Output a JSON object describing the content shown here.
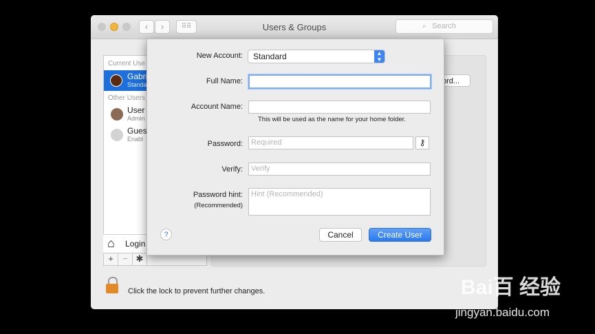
{
  "window": {
    "title": "Users & Groups",
    "search_placeholder": "Search",
    "lock_text": "Click the lock to prevent further changes."
  },
  "sidebar": {
    "current_users_label": "Current Use",
    "other_users_label": "Other Users",
    "users": [
      {
        "name": "Gabri",
        "role": "Standa"
      },
      {
        "name": "User",
        "role": "Admin"
      },
      {
        "name": "Gues",
        "role": "Enabl"
      }
    ],
    "login_label": "Login",
    "add_label": "+",
    "remove_label": "−",
    "gear_label": "✱"
  },
  "right_panel": {
    "password_button": "ord..."
  },
  "sheet": {
    "new_account_label": "New Account:",
    "new_account_value": "Standard",
    "full_name_label": "Full Name:",
    "full_name_value": "",
    "account_name_label": "Account Name:",
    "account_name_value": "",
    "account_name_hint": "This will be used as the name for your home folder.",
    "password_label": "Password:",
    "password_placeholder": "Required",
    "verify_label": "Verify:",
    "verify_placeholder": "Verify",
    "password_hint_label": "Password hint:",
    "password_hint_sub": "(Recommended)",
    "password_hint_placeholder": "Hint (Recommended)",
    "help_label": "?",
    "cancel_label": "Cancel",
    "create_label": "Create User"
  },
  "watermark": {
    "brand": "Bai百 经验",
    "url": "jingyan.baidu.com"
  },
  "colors": {
    "accent": "#2b79ec",
    "selection": "#1d6fdc"
  }
}
